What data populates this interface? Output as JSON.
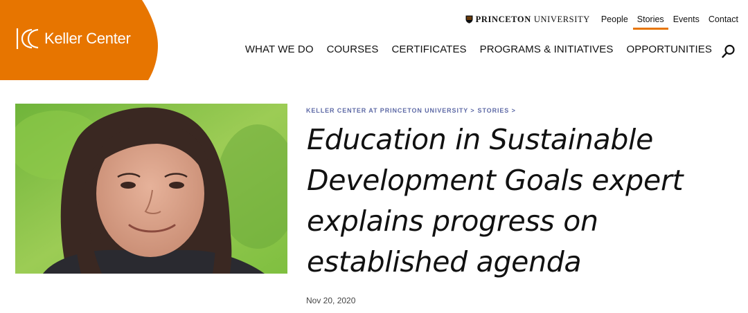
{
  "logo": {
    "text": "Keller Center"
  },
  "utility": {
    "university": {
      "bold": "PRINCETON",
      "light": "UNIVERSITY"
    },
    "links": [
      {
        "label": "People",
        "active": false
      },
      {
        "label": "Stories",
        "active": true
      },
      {
        "label": "Events",
        "active": false
      },
      {
        "label": "Contact",
        "active": false
      }
    ]
  },
  "mainnav": {
    "items": [
      "WHAT WE DO",
      "COURSES",
      "CERTIFICATES",
      "PROGRAMS & INITIATIVES",
      "OPPORTUNITIES"
    ],
    "search_icon": "search-icon"
  },
  "article": {
    "breadcrumb": [
      "KELLER CENTER AT PRINCETON UNIVERSITY >",
      "STORIES >"
    ],
    "title": "Education in Sustainable Development Goals expert explains progress on established agenda",
    "date": "Nov 20, 2020"
  },
  "colors": {
    "brand_orange": "#e77500",
    "breadcrumb": "#5e6aa6"
  }
}
